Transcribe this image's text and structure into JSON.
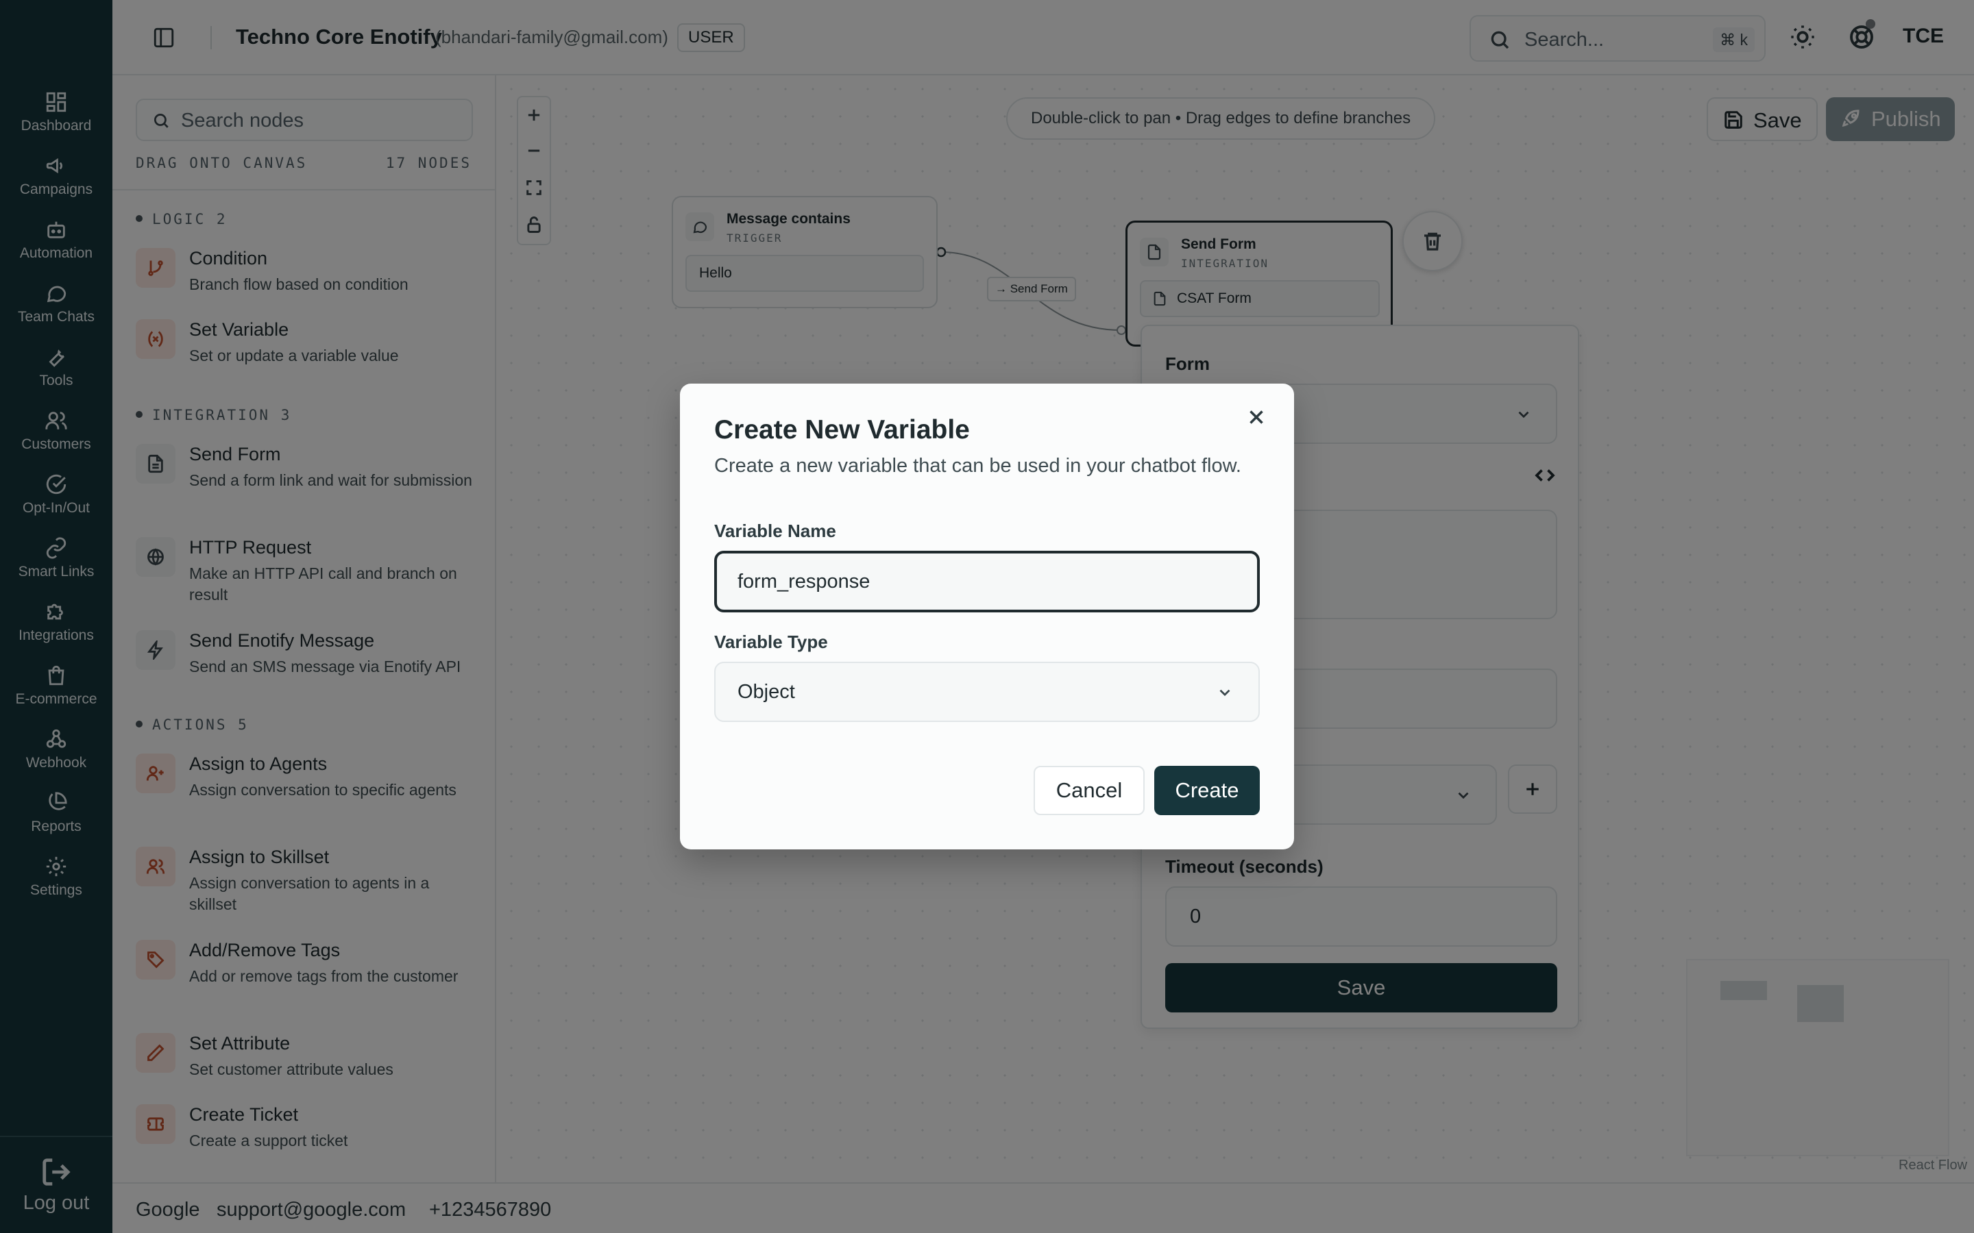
{
  "nav": {
    "items": [
      {
        "label": "Dashboard",
        "icon": "dashboard-icon"
      },
      {
        "label": "Campaigns",
        "icon": "megaphone-icon"
      },
      {
        "label": "Automation",
        "icon": "bot-icon"
      },
      {
        "label": "Team Chats",
        "icon": "chat-icon"
      },
      {
        "label": "Tools",
        "icon": "wrench-icon"
      },
      {
        "label": "Customers",
        "icon": "users-icon"
      },
      {
        "label": "Opt-In/Out",
        "icon": "check-circle-icon"
      },
      {
        "label": "Smart Links",
        "icon": "link-icon"
      },
      {
        "label": "Integrations",
        "icon": "puzzle-icon"
      },
      {
        "label": "E-commerce",
        "icon": "shopping-bag-icon"
      },
      {
        "label": "Webhook",
        "icon": "webhook-icon"
      },
      {
        "label": "Reports",
        "icon": "pie-chart-icon"
      },
      {
        "label": "Settings",
        "icon": "gear-icon"
      }
    ],
    "logout_label": "Log out"
  },
  "header": {
    "title": "Techno Core Enotify",
    "email": "(bhandari-family@gmail.com)",
    "role": "USER",
    "search_placeholder": "Search...",
    "search_shortcut": "⌘ k",
    "user_initials": "TCE"
  },
  "node_panel": {
    "search_placeholder": "Search nodes",
    "drag_hint": "DRAG ONTO CANVAS",
    "node_count": "17 NODES",
    "groups": [
      {
        "heading": "LOGIC 2",
        "items": [
          {
            "title": "Condition",
            "desc": "Branch flow based on condition"
          },
          {
            "title": "Set Variable",
            "desc": "Set or update a variable value"
          }
        ]
      },
      {
        "heading": "INTEGRATION 3",
        "items": [
          {
            "title": "Send Form",
            "desc": "Send a form link and wait for submission"
          },
          {
            "title": "HTTP Request",
            "desc": "Make an HTTP API call and branch on result"
          },
          {
            "title": "Send Enotify Message",
            "desc": "Send an SMS message via Enotify API"
          }
        ]
      },
      {
        "heading": "ACTIONS 5",
        "items": [
          {
            "title": "Assign to Agents",
            "desc": "Assign conversation to specific agents"
          },
          {
            "title": "Assign to Skillset",
            "desc": "Assign conversation to agents in a skillset"
          },
          {
            "title": "Add/Remove Tags",
            "desc": "Add or remove tags from the customer"
          },
          {
            "title": "Set Attribute",
            "desc": "Set customer attribute values"
          },
          {
            "title": "Create Ticket",
            "desc": "Create a support ticket"
          }
        ]
      }
    ]
  },
  "canvas": {
    "hint": "Double-click to pan • Drag edges to define branches",
    "save_label": "Save",
    "publish_label": "Publish",
    "trigger_node": {
      "title": "Message contains",
      "subtitle": "TRIGGER",
      "value": "Hello"
    },
    "edge_label": "→ Send Form",
    "form_node": {
      "title": "Send Form",
      "subtitle": "INTEGRATION",
      "value": "CSAT Form"
    },
    "attribution": "React Flow"
  },
  "config_panel": {
    "form_label": "Form",
    "message_fragment": "orm",
    "store_label_fragment": "to",
    "variable_fragment": "ble",
    "timeout_label": "Timeout (seconds)",
    "timeout_value": "0",
    "save_label": "Save"
  },
  "footer": {
    "company": "Google",
    "email": "support@google.com",
    "phone": "+1234567890"
  },
  "modal": {
    "title": "Create New Variable",
    "description": "Create a new variable that can be used in your chatbot flow.",
    "name_label": "Variable Name",
    "name_value": "form_response",
    "type_label": "Variable Type",
    "type_value": "Object",
    "cancel_label": "Cancel",
    "create_label": "Create"
  },
  "colors": {
    "rail": "#17363c",
    "primary": "#17363c",
    "accent_icon_bg": "#fde8e2",
    "accent_icon": "#c2502f"
  }
}
